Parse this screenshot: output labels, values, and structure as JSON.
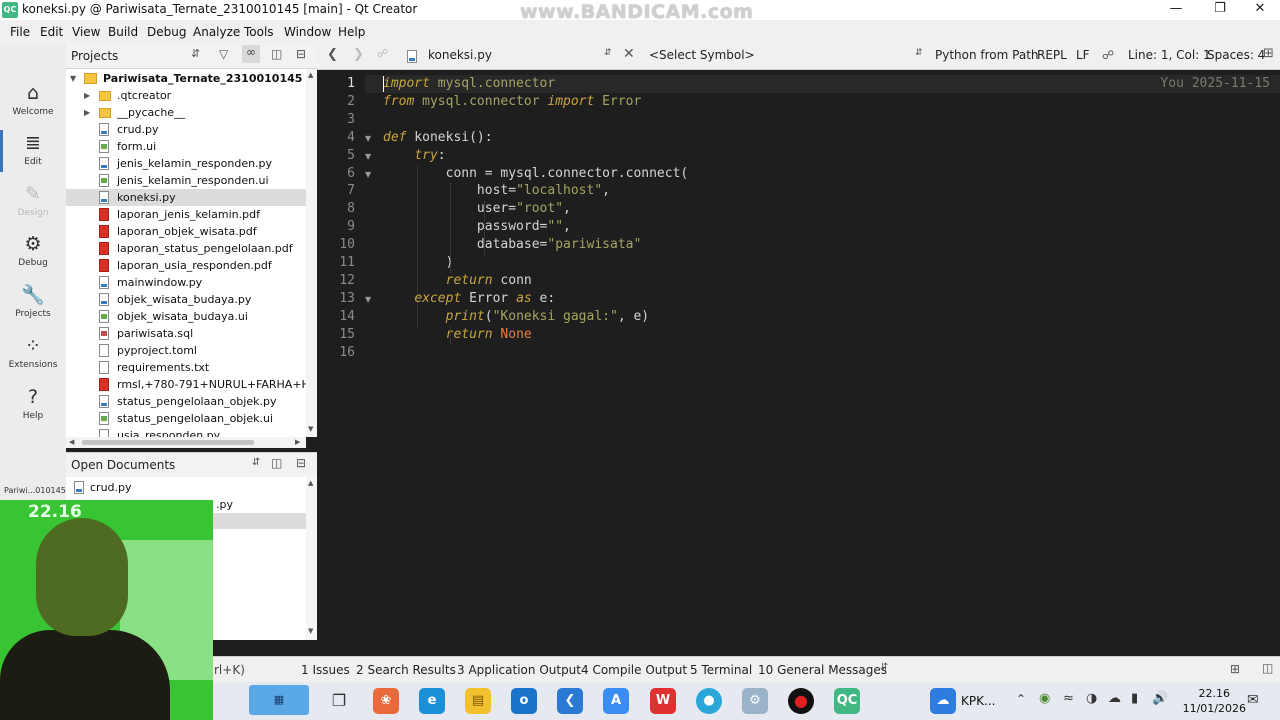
{
  "window": {
    "title": "koneksi.py @ Pariwisata_Ternate_2310010145 [main] - Qt Creator",
    "app_logo": "QC",
    "watermark": "www.BANDICAM.com"
  },
  "menu": [
    "File",
    "Edit",
    "View",
    "Build",
    "Debug",
    "Analyze",
    "Tools",
    "Window",
    "Help"
  ],
  "modes": [
    {
      "label": "Welcome",
      "icon": "⌂"
    },
    {
      "label": "Edit",
      "icon": "≣"
    },
    {
      "label": "Design",
      "icon": "✎"
    },
    {
      "label": "Debug",
      "icon": "⚙"
    },
    {
      "label": "Projects",
      "icon": "🔧"
    },
    {
      "label": "Extensions",
      "icon": "⁘"
    },
    {
      "label": "Help",
      "icon": "?"
    }
  ],
  "projects_panel": {
    "title": "Projects",
    "root": "Pariwisata_Ternate_2310010145 [main",
    "items": [
      {
        "name": ".qtcreator",
        "type": "folder"
      },
      {
        "name": "__pycache__",
        "type": "folder"
      },
      {
        "name": "crud.py",
        "type": "py"
      },
      {
        "name": "form.ui",
        "type": "ui"
      },
      {
        "name": "jenis_kelamin_responden.py",
        "type": "py"
      },
      {
        "name": "jenis_kelamin_responden.ui",
        "type": "ui"
      },
      {
        "name": "koneksi.py",
        "type": "py",
        "selected": true
      },
      {
        "name": "laporan_jenis_kelamin.pdf",
        "type": "pdf"
      },
      {
        "name": "laporan_objek_wisata.pdf",
        "type": "pdf"
      },
      {
        "name": "laporan_status_pengelolaan.pdf",
        "type": "pdf"
      },
      {
        "name": "laporan_usia_responden.pdf",
        "type": "pdf"
      },
      {
        "name": "mainwindow.py",
        "type": "py"
      },
      {
        "name": "objek_wisata_budaya.py",
        "type": "py"
      },
      {
        "name": "objek_wisata_budaya.ui",
        "type": "ui"
      },
      {
        "name": "pariwisata.sql",
        "type": "sql"
      },
      {
        "name": "pyproject.toml",
        "type": "doc"
      },
      {
        "name": "requirements.txt",
        "type": "doc"
      },
      {
        "name": "rmsl,+780-791+NURUL+FARHA+HI+A",
        "type": "pdf"
      },
      {
        "name": "status_pengelolaan_objek.py",
        "type": "py"
      },
      {
        "name": "status_pengelolaan_objek.ui",
        "type": "ui"
      },
      {
        "name": "usia_responden.py",
        "type": "py"
      }
    ]
  },
  "open_documents": {
    "title": "Open Documents",
    "items": [
      "crud.py",
      ".py"
    ],
    "left_fragment": "Pariwi...010145",
    "locator_hint": "rl+K)"
  },
  "editor_toolbar": {
    "file": "koneksi.py",
    "symbol": "<Select Symbol>",
    "interpreter": "Python from Path",
    "repl": "REPL",
    "line_ending": "LF",
    "position": "Line: 1, Col: 1",
    "indent": "Spaces: 4"
  },
  "editor": {
    "blame": "You 2025-11-15",
    "current_line": 1,
    "fold_lines": [
      4,
      5,
      6,
      13
    ],
    "lines": [
      [
        [
          "k",
          "import"
        ],
        [
          "m",
          " mysql.connector"
        ]
      ],
      [
        [
          "k",
          "from"
        ],
        [
          "m",
          " mysql.connector "
        ],
        [
          "k",
          "import"
        ],
        [
          "m",
          " Error"
        ]
      ],
      [],
      [
        [
          "k",
          "def"
        ],
        [
          "f",
          " koneksi():"
        ]
      ],
      [
        [
          "f",
          "    "
        ],
        [
          "k",
          "try"
        ],
        [
          "f",
          ":"
        ]
      ],
      [
        [
          "f",
          "        conn = mysql.connector.connect("
        ]
      ],
      [
        [
          "f",
          "            host="
        ],
        [
          "s",
          "\"localhost\""
        ],
        [
          "f",
          ","
        ]
      ],
      [
        [
          "f",
          "            user="
        ],
        [
          "s",
          "\"root\""
        ],
        [
          "f",
          ","
        ]
      ],
      [
        [
          "f",
          "            password="
        ],
        [
          "s",
          "\"\""
        ],
        [
          "f",
          ","
        ]
      ],
      [
        [
          "f",
          "            database="
        ],
        [
          "s",
          "\"pariwisata\""
        ]
      ],
      [
        [
          "f",
          "        )"
        ]
      ],
      [
        [
          "f",
          "        "
        ],
        [
          "k",
          "return"
        ],
        [
          "f",
          " conn"
        ]
      ],
      [
        [
          "f",
          "    "
        ],
        [
          "k",
          "except"
        ],
        [
          "f",
          " Error "
        ],
        [
          "k",
          "as"
        ],
        [
          "f",
          " e:"
        ]
      ],
      [
        [
          "f",
          "        "
        ],
        [
          "k",
          "print"
        ],
        [
          "f",
          "("
        ],
        [
          "s",
          "\"Koneksi gagal:\""
        ],
        [
          "f",
          ", e)"
        ]
      ],
      [
        [
          "f",
          "        "
        ],
        [
          "k",
          "return"
        ],
        [
          "n",
          " None"
        ]
      ],
      []
    ]
  },
  "output_tabs": [
    "1  Issues",
    "2  Search Results",
    "3  Application Output",
    "4  Compile Output",
    "5  Terminal",
    "10  General Messages"
  ],
  "taskbar": {
    "weather": "KPK...",
    "time": "22.16",
    "date": "11/01/2026"
  },
  "webcam": {
    "timestamp": "22.16"
  }
}
